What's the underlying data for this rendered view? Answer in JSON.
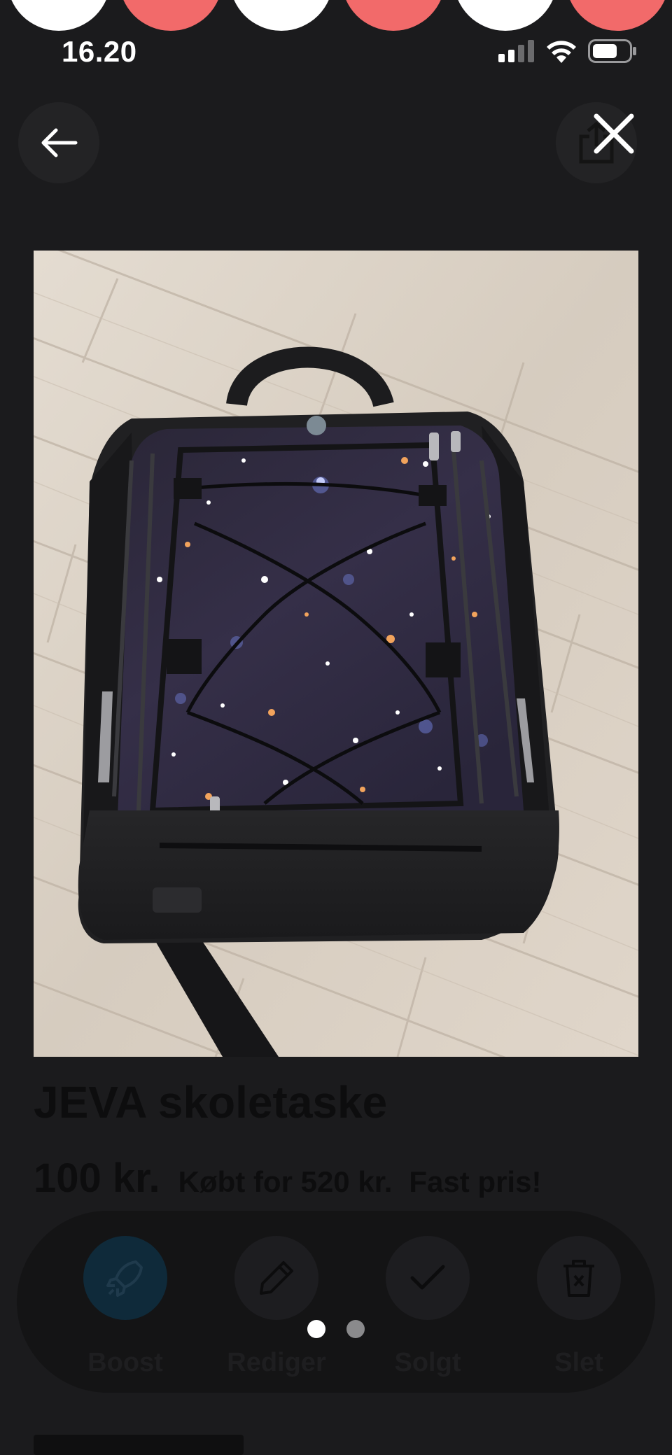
{
  "status_bar": {
    "time": "16.20"
  },
  "listing": {
    "title": "JEVA skoletaske",
    "price": "100 kr.",
    "bought_for": "Købt for 520 kr.",
    "fixed_price": "Fast pris!"
  },
  "actions": [
    {
      "label": "Boost",
      "icon": "rocket-icon"
    },
    {
      "label": "Rediger",
      "icon": "pencil-icon"
    },
    {
      "label": "Solgt",
      "icon": "check-icon"
    },
    {
      "label": "Slet",
      "icon": "trash-icon"
    }
  ],
  "carousel": {
    "total_pages": 2,
    "active_page": 1
  },
  "colors": {
    "background": "#1b1b1d",
    "story_pink": "#f26a6a",
    "story_white": "#ffffff",
    "active_dot": "#ffffff",
    "inactive_dot": "#8a8a8c"
  }
}
